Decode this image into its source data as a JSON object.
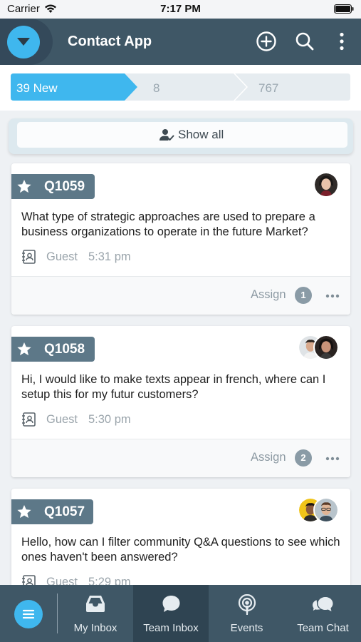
{
  "status_bar": {
    "carrier": "Carrier",
    "time": "7:17 PM"
  },
  "header": {
    "title": "Contact App"
  },
  "tabs": [
    {
      "label": "39 New",
      "active": true
    },
    {
      "label": "8",
      "active": false
    },
    {
      "label": "767",
      "active": false
    }
  ],
  "filter": {
    "show_all_label": "Show all"
  },
  "cards": [
    {
      "id": "Q1059",
      "text": "What type of strategic approaches are used to prepare a business organizations to operate in the future Market?",
      "author": "Guest",
      "time": "5:31 pm",
      "assign_label": "Assign",
      "assign_count": "1"
    },
    {
      "id": "Q1058",
      "text": "Hi, I would like to make texts appear in french, where can I setup this for my futur customers?",
      "author": "Guest",
      "time": "5:30 pm",
      "assign_label": "Assign",
      "assign_count": "2"
    },
    {
      "id": "Q1057",
      "text": "Hello, how can I filter community Q&A questions to see which ones haven't been answered?",
      "author": "Guest",
      "time": "5:29 pm"
    }
  ],
  "bottom_nav": {
    "items": [
      {
        "label": "My Inbox",
        "icon": "inbox-icon",
        "active": false
      },
      {
        "label": "Team Inbox",
        "icon": "chat-bubble-icon",
        "active": true
      },
      {
        "label": "Events",
        "icon": "podcast-icon",
        "active": false
      },
      {
        "label": "Team Chat",
        "icon": "chat-bubbles-icon",
        "active": false
      }
    ]
  },
  "colors": {
    "header": "#3f5766",
    "accent": "#3fb7ee",
    "tag": "#5d7888"
  }
}
